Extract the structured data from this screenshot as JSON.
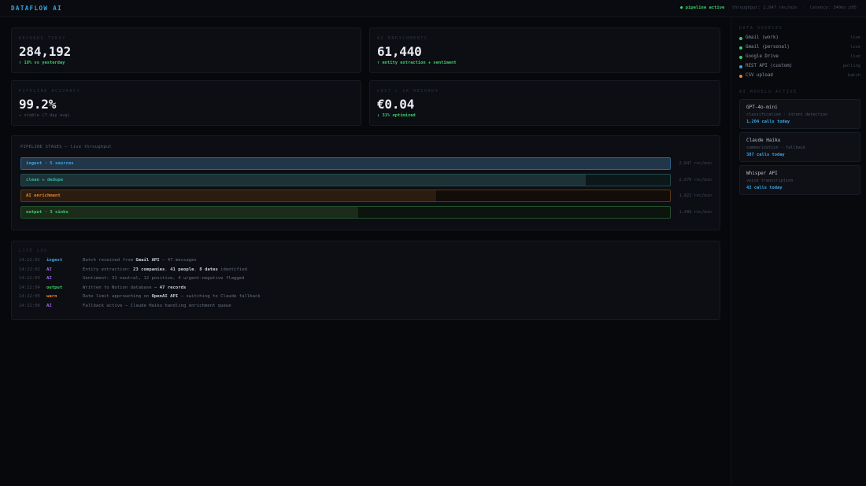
{
  "app": {
    "brand": "DATAFLOW AI",
    "status": "● pipeline active",
    "throughput": "throughput: 2,847 rec/min",
    "latency": "latency: 340ms p95"
  },
  "metrics": [
    {
      "label": "RECORDS TODAY",
      "value": "284,192",
      "note": "↑ 18% vs yesterday",
      "note_color": "green"
    },
    {
      "label": "AI ENRICHMENTS",
      "value": "61,440",
      "note": "↑ entity extraction + sentiment",
      "note_color": "green"
    },
    {
      "label": "PIPELINE ACCURACY",
      "value": "99.2%",
      "note": "→ stable (7 day avg)",
      "note_color": "muted"
    },
    {
      "label": "COST / 1K RECORDS",
      "value": "€0.04",
      "note": "↓ 31% optimized",
      "note_color": "green"
    }
  ],
  "pipeline": {
    "title": "PIPELINE STAGES — live throughput",
    "stages": [
      {
        "label": "ingest · 5 sources",
        "rate": "2,847 rec/min",
        "fill": 1.0,
        "color": "#38a8e8",
        "bg": "#22364a",
        "border": "#2f6790",
        "track": "#0e1a24"
      },
      {
        "label": "clean + dedupe",
        "rate": "2,670 rec/min",
        "fill": 0.87,
        "color": "#2ab7a6",
        "bg": "#1c3235",
        "border": "#234b4c",
        "track": "#0c1719"
      },
      {
        "label": "AI enrichment",
        "rate": "1,822 rec/min",
        "fill": 0.64,
        "color": "#e8842c",
        "bg": "#2b1c10",
        "border": "#5c3a16",
        "track": "#120d09"
      },
      {
        "label": "output · 3 sinks",
        "rate": "1,488 rec/min",
        "fill": 0.52,
        "color": "#3ccf6a",
        "bg": "#1b2c1a",
        "border": "#24502e",
        "track": "#0c150d"
      }
    ]
  },
  "log": {
    "title": "LIVE LOG",
    "entries": [
      {
        "time": "14:22:01",
        "tag": "ingest",
        "tag_color": "#38a8e8",
        "parts": [
          [
            "Batch received from ",
            false
          ],
          [
            "Gmail API",
            true
          ],
          [
            " — 47 messages",
            false
          ]
        ]
      },
      {
        "time": "14:22:02",
        "tag": "AI",
        "tag_color": "#a46cf0",
        "parts": [
          [
            "Entity extraction: ",
            false
          ],
          [
            "23 companies",
            true
          ],
          [
            ", ",
            false
          ],
          [
            "41 people",
            true
          ],
          [
            ", ",
            false
          ],
          [
            "8 dates",
            true
          ],
          [
            " identified",
            false
          ]
        ]
      },
      {
        "time": "14:22:03",
        "tag": "AI",
        "tag_color": "#a46cf0",
        "parts": [
          [
            "Sentiment: 31 neutral, 12 positive, 4 urgent-negative flagged",
            false
          ]
        ]
      },
      {
        "time": "14:22:04",
        "tag": "output",
        "tag_color": "#3ccf6a",
        "parts": [
          [
            "Written to Notion database → ",
            false
          ],
          [
            "47 records",
            true
          ]
        ]
      },
      {
        "time": "14:22:05",
        "tag": "warn",
        "tag_color": "#e8842c",
        "parts": [
          [
            "Rate limit approaching on ",
            false
          ],
          [
            "OpenAI API",
            true
          ],
          [
            " — switching to Claude fallback",
            false
          ]
        ]
      },
      {
        "time": "14:22:06",
        "tag": "AI",
        "tag_color": "#a46cf0",
        "parts": [
          [
            "Fallback active — Claude Haiku handling enrichment queue",
            false
          ]
        ]
      }
    ]
  },
  "sidebar": {
    "sources_title": "DATA SOURCES",
    "sources": [
      {
        "name": "Gmail (work)",
        "status": "live",
        "color": "#3ccf6a"
      },
      {
        "name": "Gmail (personal)",
        "status": "live",
        "color": "#3ccf6a"
      },
      {
        "name": "Google Drive",
        "status": "live",
        "color": "#3ccf6a"
      },
      {
        "name": "REST API (custom)",
        "status": "polling",
        "color": "#38a8e8"
      },
      {
        "name": "CSV upload",
        "status": "batch",
        "color": "#e8842c"
      }
    ],
    "models_title": "AI MODELS ACTIVE",
    "models": [
      {
        "name": "GPT-4o-mini",
        "desc": "classification · intent detection",
        "calls": "1,204 calls today"
      },
      {
        "name": "Claude Haiku",
        "desc": "summarization · fallback",
        "calls": "387 calls today"
      },
      {
        "name": "Whisper API",
        "desc": "voice transcription",
        "calls": "42 calls today"
      }
    ]
  }
}
